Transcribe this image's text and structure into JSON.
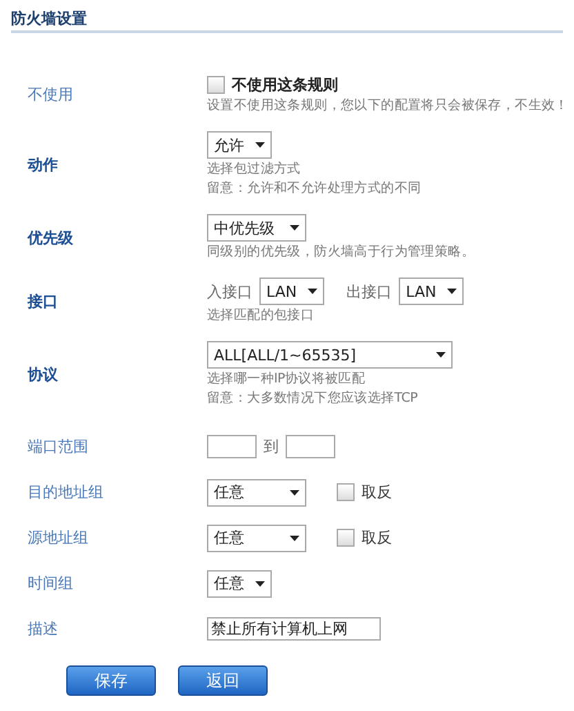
{
  "title": "防火墙设置",
  "fields": [
    {
      "kind": "checkbox",
      "label": "不使用",
      "bold": false,
      "checkbox_label": "不使用这条规则",
      "checked": false,
      "hints": [
        "设置不使用这条规则，您以下的配置将只会被保存，不生效！"
      ]
    },
    {
      "kind": "select",
      "label": "动作",
      "bold": true,
      "value": "允许",
      "hints": [
        "选择包过滤方式",
        "留意：允许和不允许处理方式的不同"
      ]
    },
    {
      "kind": "select",
      "label": "优先级",
      "bold": true,
      "value": "中优先级",
      "hints": [
        "同级别的优先级，防火墙高于行为管理策略。"
      ]
    },
    {
      "kind": "interfaces",
      "label": "接口",
      "bold": true,
      "in_label": "入接口",
      "in_value": "LAN",
      "out_label": "出接口",
      "out_value": "LAN",
      "hints": [
        "选择匹配的包接口"
      ]
    },
    {
      "kind": "select_wide",
      "label": "协议",
      "bold": true,
      "value": "ALL[ALL/1~65535]",
      "hints": [
        "选择哪一种IP协议将被匹配",
        "留意：大多数情况下您应该选择TCP"
      ]
    },
    {
      "kind": "range",
      "label": "端口范围",
      "bold": false,
      "separator": "到"
    },
    {
      "kind": "select_invert",
      "label": "目的地址组",
      "bold": false,
      "value": "任意",
      "invert_label": "取反",
      "invert_checked": false
    },
    {
      "kind": "select_invert",
      "label": "源地址组",
      "bold": false,
      "value": "任意",
      "invert_label": "取反",
      "invert_checked": false
    },
    {
      "kind": "select",
      "label": "时间组",
      "bold": false,
      "value": "任意"
    },
    {
      "kind": "text",
      "label": "描述",
      "bold": false,
      "value": "禁止所有计算机上网"
    }
  ],
  "buttons": [
    "保存",
    "返回"
  ]
}
